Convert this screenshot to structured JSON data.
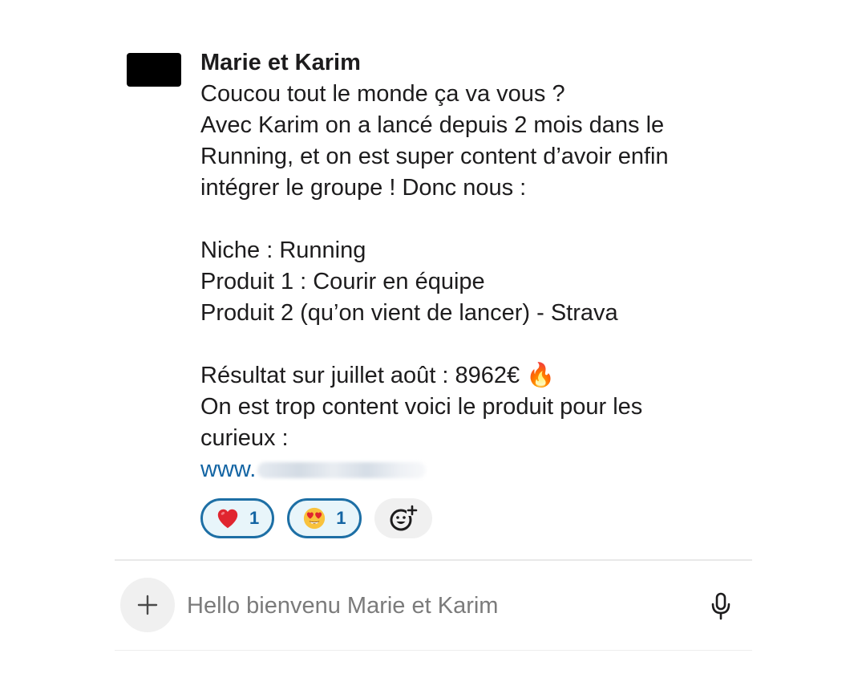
{
  "message": {
    "sender": "Marie et Karim",
    "body_lines": [
      "Coucou tout le monde ça va vous ?",
      "Avec Karim on a lancé depuis 2 mois dans le",
      "Running, et on est super content d’avoir enfin",
      "intégrer le groupe ! Donc nous :",
      "",
      "Niche : Running",
      "Produit 1 : Courir en équipe",
      "Produit 2 (qu’on vient de lancer) - Strava",
      "",
      "Résultat sur juillet août : 8962€ 🔥",
      "On est trop content voici le produit pour les",
      "curieux :"
    ],
    "link_visible_text": "www.",
    "reactions": [
      {
        "icon": "red-heart-emoji",
        "count": "1"
      },
      {
        "icon": "heart-eyes-emoji",
        "count": "1"
      }
    ],
    "add_reaction_icon": "add-reaction-icon"
  },
  "composer": {
    "placeholder": "Hello bienvenu Marie et Karim",
    "plus_icon": "plus-icon",
    "mic_icon": "microphone-icon"
  },
  "colors": {
    "text": "#1d1c1d",
    "link": "#1264a3",
    "reaction_border": "#1d6fa5",
    "reaction_bg": "#e8f5fa",
    "placeholder": "#7b7b7b"
  }
}
